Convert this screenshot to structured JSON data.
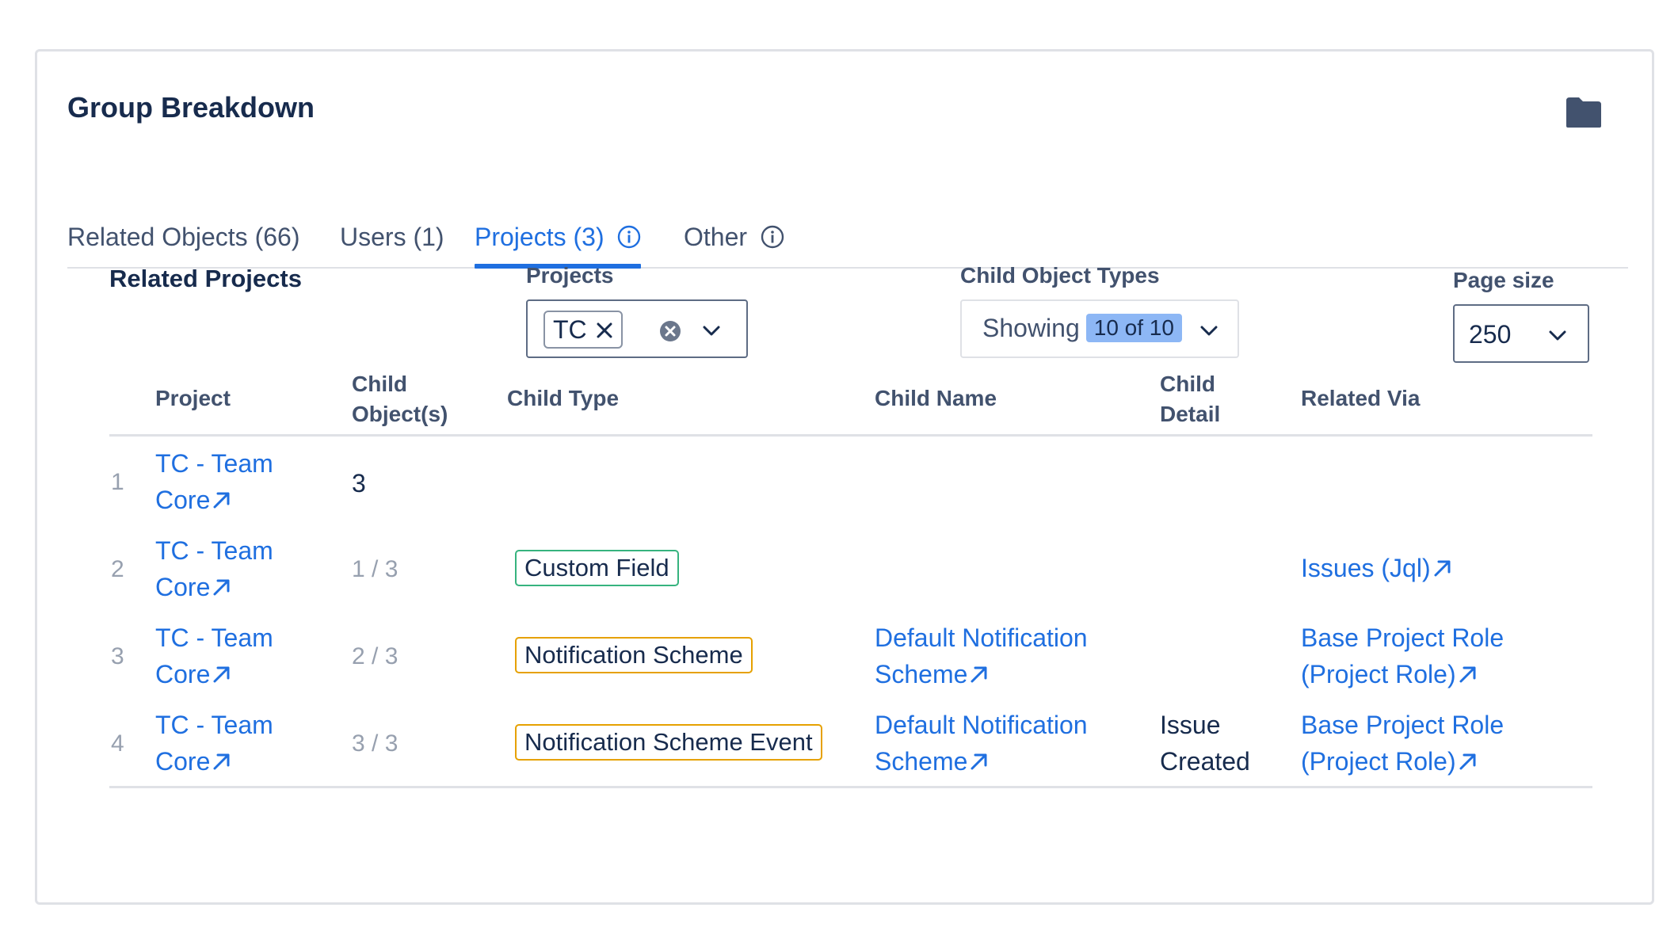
{
  "card": {
    "title": "Group Breakdown",
    "folder_icon": "folder-icon"
  },
  "tabs": [
    {
      "label": "Related Objects (66)",
      "active": false
    },
    {
      "label": "Users (1)",
      "active": false
    },
    {
      "label": "Projects (3)",
      "active": true,
      "info": true
    },
    {
      "label": "Other",
      "active": false,
      "info": true
    }
  ],
  "section": {
    "title": "Related Projects"
  },
  "filters": {
    "projects": {
      "label": "Projects",
      "chip": "TC"
    },
    "child_types": {
      "label": "Child Object Types",
      "text": "Showing",
      "badge": "10 of 10"
    },
    "page_size": {
      "label": "Page size",
      "value": "250"
    }
  },
  "table": {
    "headers": {
      "project": "Project",
      "child_objects_1": "Child",
      "child_objects_2": "Object(s)",
      "child_type": "Child Type",
      "child_name": "Child Name",
      "child_detail_1": "Child",
      "child_detail_2": "Detail",
      "related_via": "Related Via"
    },
    "rows": [
      {
        "num": "1",
        "project_1": "TC - Team",
        "project_2": "Core",
        "count": "3",
        "child_type": "",
        "name_1": "",
        "name_2": "",
        "detail_1": "",
        "detail_2": "",
        "via_1": "",
        "via_2": ""
      },
      {
        "num": "2",
        "project_1": "TC - Team",
        "project_2": "Core",
        "count": "1 / 3",
        "child_type": "Custom Field",
        "name_1": "",
        "name_2": "",
        "detail_1": "",
        "detail_2": "",
        "via_1": "Issues (Jql)",
        "via_2": ""
      },
      {
        "num": "3",
        "project_1": "TC - Team",
        "project_2": "Core",
        "count": "2 / 3",
        "child_type": "Notification Scheme",
        "name_1": "Default Notification",
        "name_2": "Scheme",
        "detail_1": "",
        "detail_2": "",
        "via_1": "Base Project Role",
        "via_2": "(Project Role)"
      },
      {
        "num": "4",
        "project_1": "TC - Team",
        "project_2": "Core",
        "count": "3 / 3",
        "child_type": "Notification Scheme Event",
        "name_1": "Default Notification",
        "name_2": "Scheme",
        "detail_1": "Issue",
        "detail_2": "Created",
        "via_1": "Base Project Role",
        "via_2": "(Project Role)"
      }
    ]
  },
  "colors": {
    "link": "#1f6fe0",
    "tag_custom_field": "#36b37e",
    "tag_notification": "#e6a100",
    "badge": "#8db7f5"
  }
}
